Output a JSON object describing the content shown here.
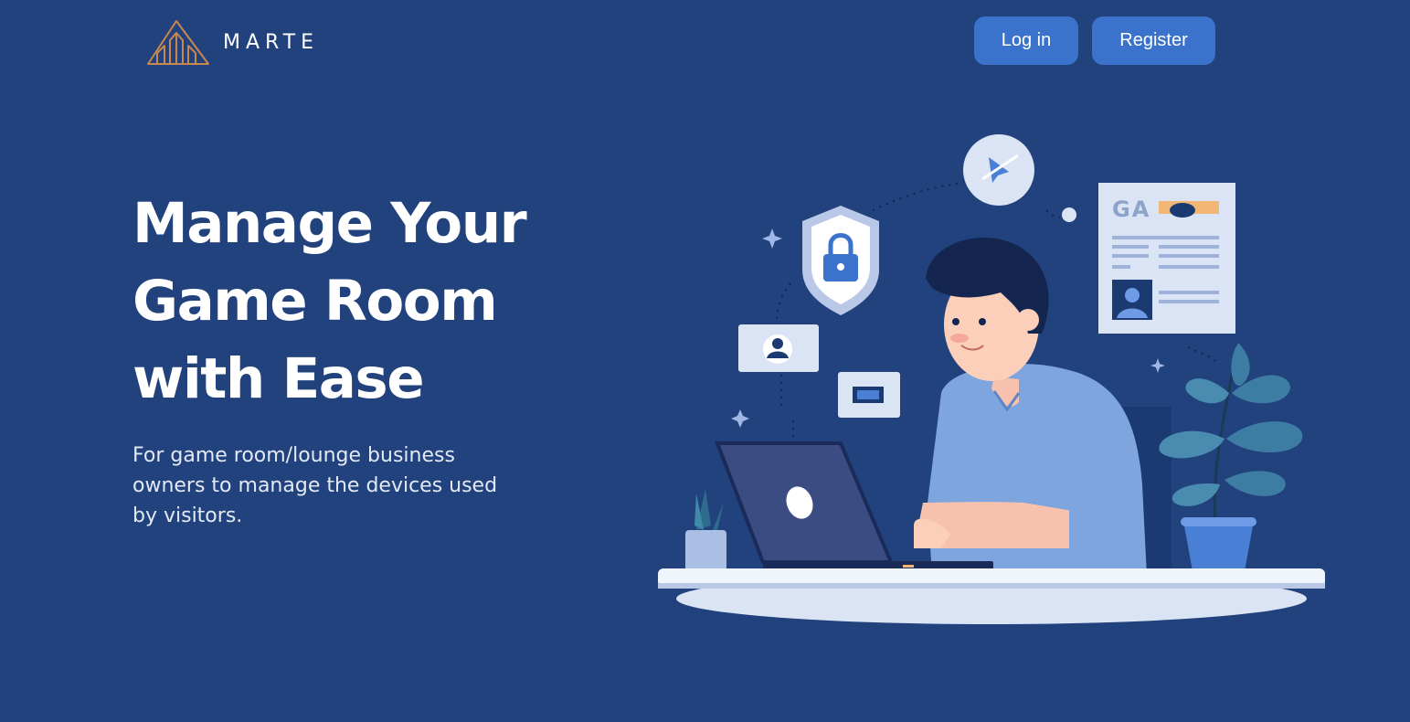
{
  "header": {
    "brand": "MARTE",
    "logo_icon": "pyramid-logo-icon",
    "login_label": "Log in",
    "register_label": "Register"
  },
  "hero": {
    "title": "Manage Your Game Room with Ease",
    "subtitle": "For game room/lounge business owners to manage the devices used by visitors."
  },
  "illustration": {
    "document_letters": "GA"
  },
  "colors": {
    "background": "#21427d",
    "button": "#3a72cc",
    "logo": "#c8874e",
    "text": "#ffffff"
  }
}
